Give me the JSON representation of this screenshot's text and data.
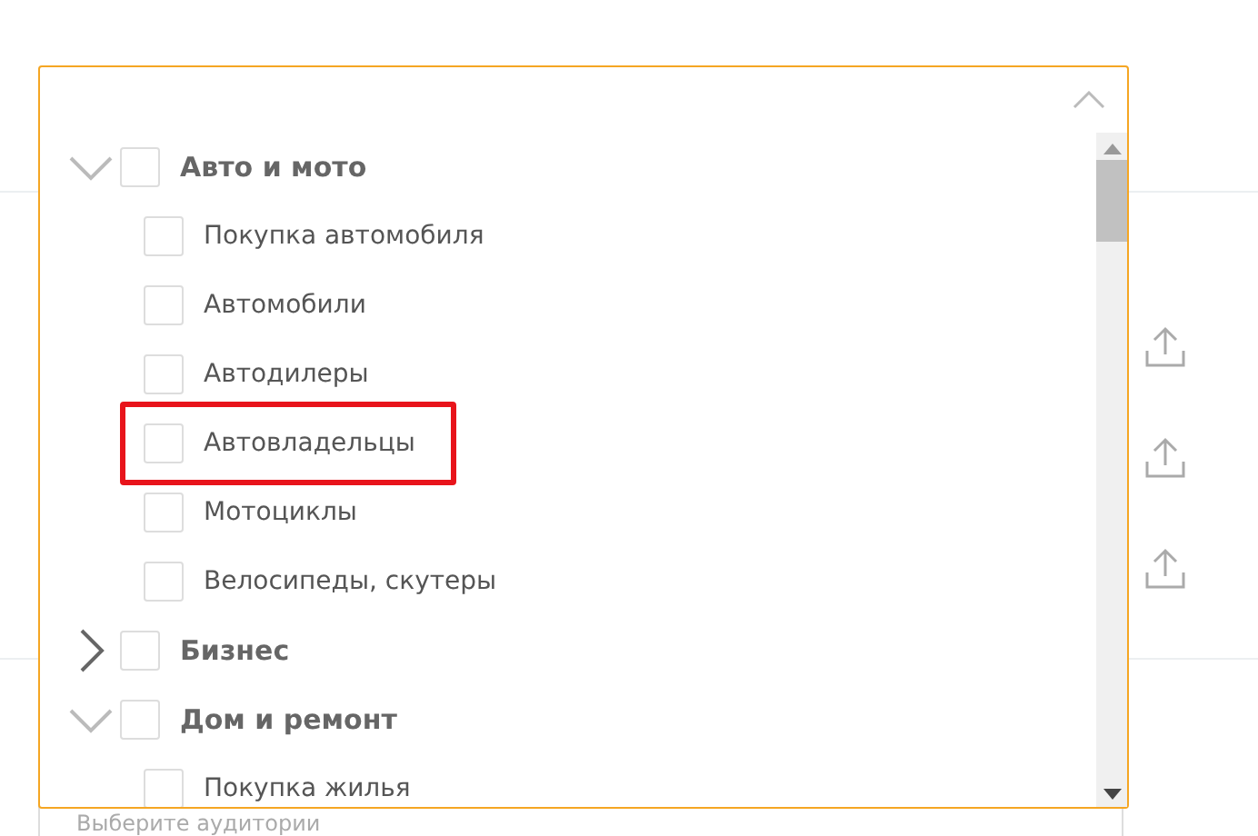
{
  "categories": [
    {
      "label": "Авто и мото",
      "expanded": true,
      "checked": false,
      "children": [
        {
          "label": "Покупка автомобиля",
          "checked": false,
          "highlighted": false
        },
        {
          "label": "Автомобили",
          "checked": false,
          "highlighted": false
        },
        {
          "label": "Автодилеры",
          "checked": false,
          "highlighted": false
        },
        {
          "label": "Автовладельцы",
          "checked": false,
          "highlighted": true
        },
        {
          "label": "Мотоциклы",
          "checked": false,
          "highlighted": false
        },
        {
          "label": "Велосипеды, скутеры",
          "checked": false,
          "highlighted": false
        }
      ]
    },
    {
      "label": "Бизнес",
      "expanded": false,
      "checked": false
    },
    {
      "label": "Дом и ремонт",
      "expanded": true,
      "checked": false,
      "children": [
        {
          "label": "Покупка жилья",
          "checked": false,
          "highlighted": false
        }
      ]
    }
  ],
  "audience_field": {
    "placeholder": "Выберите аудитории"
  }
}
